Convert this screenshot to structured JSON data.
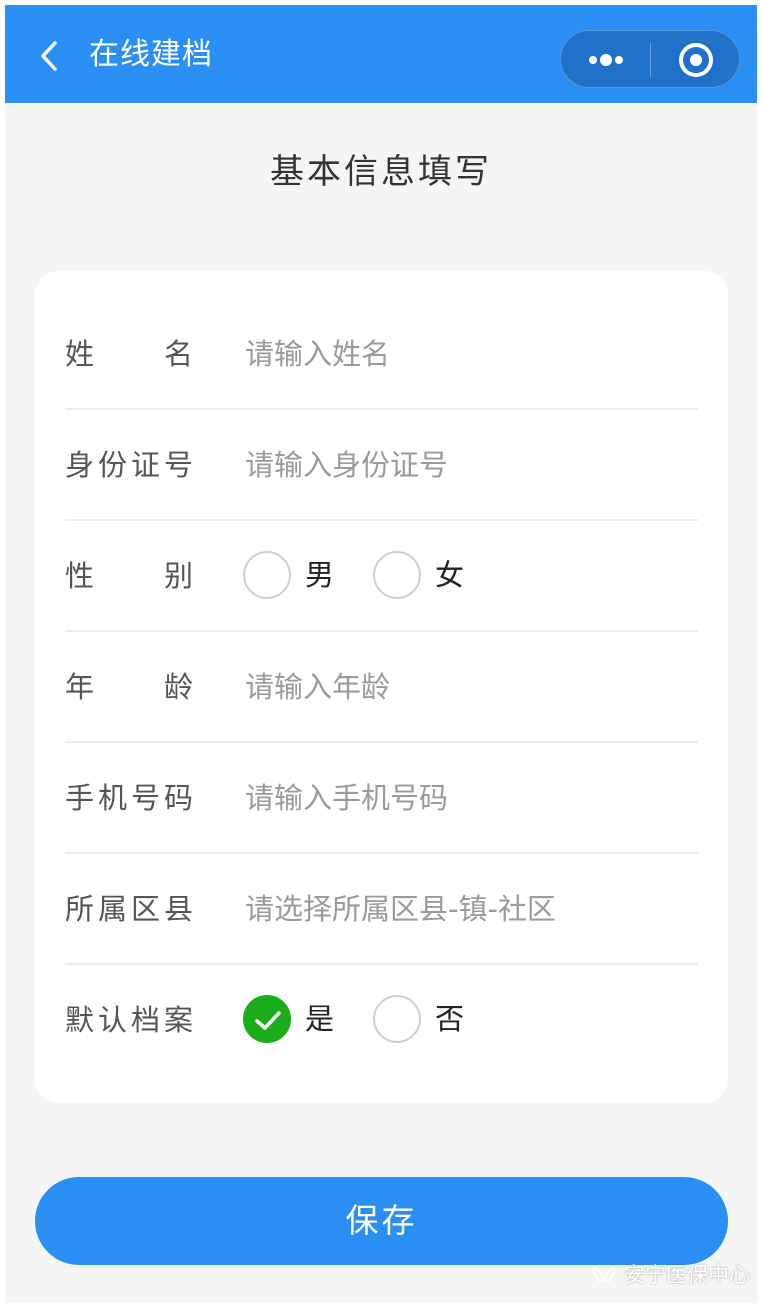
{
  "navbar": {
    "title": "在线建档",
    "back_icon": "chevron-left-icon",
    "more_icon": "more-dots-icon",
    "close_icon": "target-circle-icon",
    "bg_color": "#2b8ef3"
  },
  "page_title": "基本信息填写",
  "form": {
    "name": {
      "label": "姓名",
      "placeholder": "请输入姓名"
    },
    "id_number": {
      "label": "身份证号",
      "placeholder": "请输入身份证号"
    },
    "gender": {
      "label": "性别",
      "options": [
        {
          "label": "男",
          "checked": false
        },
        {
          "label": "女",
          "checked": false
        }
      ]
    },
    "age": {
      "label": "年龄",
      "placeholder": "请输入年龄"
    },
    "phone": {
      "label": "手机号码",
      "placeholder": "请输入手机号码"
    },
    "district": {
      "label": "所属区县",
      "placeholder": "请选择所属区县-镇-社区"
    },
    "default_archive": {
      "label": "默认档案",
      "options": [
        {
          "label": "是",
          "checked": true
        },
        {
          "label": "否",
          "checked": false
        }
      ]
    }
  },
  "save_button": {
    "label": "保存",
    "color": "#2b8ef3"
  },
  "watermark": {
    "text": "安宁医保中心",
    "icon": "wechat-channel-icon"
  },
  "colors": {
    "checked_radio": "#1aad19",
    "page_bg": "#f5f5f5"
  }
}
